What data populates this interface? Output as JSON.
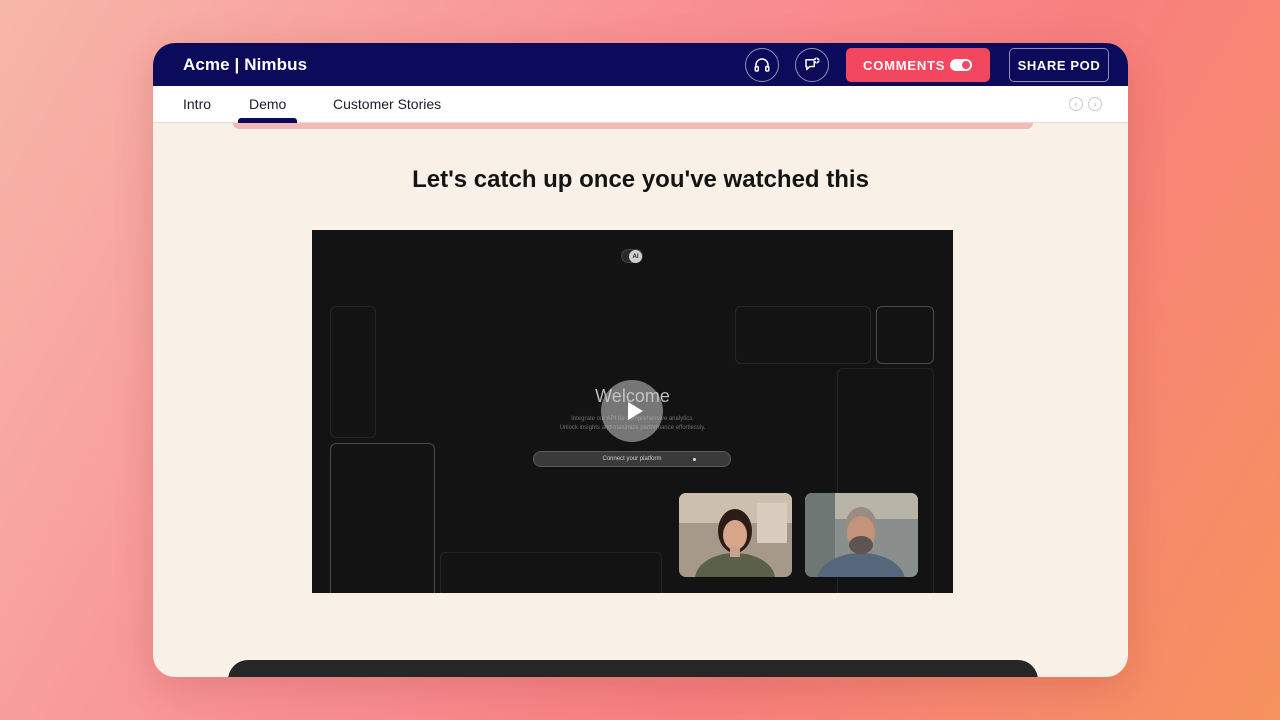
{
  "app": {
    "title": "Acme | Nimbus"
  },
  "toolbar": {
    "support_icon": "headphones-icon",
    "chat_icon": "chat-add-icon",
    "comments_label": "COMMENTS",
    "share_label": "SHARE POD"
  },
  "tabs": [
    {
      "label": "Intro"
    },
    {
      "label": "Demo",
      "active": true
    },
    {
      "label": "Customer Stories"
    }
  ],
  "main": {
    "headline": "Let's catch up once you've watched this"
  },
  "video": {
    "ai_badge": "AI",
    "welcome": "Welcome",
    "line1": "Integrate our API for comprehensive analytics.",
    "line2": "Unlock insights and maximize performance effortlessly.",
    "connect_label": "Connect your platform"
  },
  "colors": {
    "navy": "#0c0a5a",
    "accent": "#f2475f",
    "page_bg": "#f9f1e7"
  }
}
